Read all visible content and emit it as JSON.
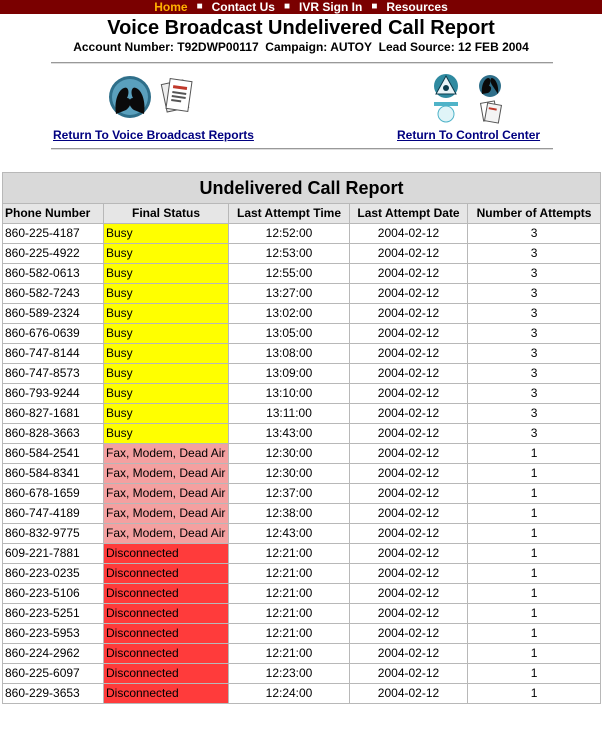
{
  "nav": {
    "items": [
      {
        "label": "Home",
        "active": true
      },
      {
        "label": "Contact Us",
        "active": false
      },
      {
        "label": "IVR Sign In",
        "active": false
      },
      {
        "label": "Resources",
        "active": false
      }
    ],
    "separator": "■",
    "bar_color": "#7a0000",
    "active_color": "#ffb000"
  },
  "header": {
    "title": "Voice Broadcast Undelivered Call Report",
    "account_label": "Account Number:",
    "account_number": "T92DWP00117",
    "campaign_label": "Campaign:",
    "campaign": "AUTOY",
    "lead_source_label": "Lead Source:",
    "lead_source": "12 FEB 2004"
  },
  "links": {
    "voice_broadcast_reports": "Return To Voice Broadcast Reports",
    "control_center": "Return To Control Center",
    "voice_broadcast_icon": "people-heads-icon",
    "reports_icon": "report-documents-icon",
    "control_center_icon": "control-center-icons"
  },
  "table": {
    "caption": "Undelivered Call Report",
    "columns": [
      "Phone Number",
      "Final Status",
      "Last Attempt Time",
      "Last Attempt Date",
      "Number of Attempts"
    ],
    "status_colors": {
      "Busy": "#ffff00",
      "Fax, Modem, Dead Air": "#f4a0a0",
      "Disconnected": "#ff3b3b"
    },
    "rows": [
      {
        "phone": "860-225-4187",
        "status": "Busy",
        "time": "12:52:00",
        "date": "2004-02-12",
        "attempts": "3"
      },
      {
        "phone": "860-225-4922",
        "status": "Busy",
        "time": "12:53:00",
        "date": "2004-02-12",
        "attempts": "3"
      },
      {
        "phone": "860-582-0613",
        "status": "Busy",
        "time": "12:55:00",
        "date": "2004-02-12",
        "attempts": "3"
      },
      {
        "phone": "860-582-7243",
        "status": "Busy",
        "time": "13:27:00",
        "date": "2004-02-12",
        "attempts": "3"
      },
      {
        "phone": "860-589-2324",
        "status": "Busy",
        "time": "13:02:00",
        "date": "2004-02-12",
        "attempts": "3"
      },
      {
        "phone": "860-676-0639",
        "status": "Busy",
        "time": "13:05:00",
        "date": "2004-02-12",
        "attempts": "3"
      },
      {
        "phone": "860-747-8144",
        "status": "Busy",
        "time": "13:08:00",
        "date": "2004-02-12",
        "attempts": "3"
      },
      {
        "phone": "860-747-8573",
        "status": "Busy",
        "time": "13:09:00",
        "date": "2004-02-12",
        "attempts": "3"
      },
      {
        "phone": "860-793-9244",
        "status": "Busy",
        "time": "13:10:00",
        "date": "2004-02-12",
        "attempts": "3"
      },
      {
        "phone": "860-827-1681",
        "status": "Busy",
        "time": "13:11:00",
        "date": "2004-02-12",
        "attempts": "3"
      },
      {
        "phone": "860-828-3663",
        "status": "Busy",
        "time": "13:43:00",
        "date": "2004-02-12",
        "attempts": "3"
      },
      {
        "phone": "860-584-2541",
        "status": "Fax, Modem, Dead Air",
        "time": "12:30:00",
        "date": "2004-02-12",
        "attempts": "1"
      },
      {
        "phone": "860-584-8341",
        "status": "Fax, Modem, Dead Air",
        "time": "12:30:00",
        "date": "2004-02-12",
        "attempts": "1"
      },
      {
        "phone": "860-678-1659",
        "status": "Fax, Modem, Dead Air",
        "time": "12:37:00",
        "date": "2004-02-12",
        "attempts": "1"
      },
      {
        "phone": "860-747-4189",
        "status": "Fax, Modem, Dead Air",
        "time": "12:38:00",
        "date": "2004-02-12",
        "attempts": "1"
      },
      {
        "phone": "860-832-9775",
        "status": "Fax, Modem, Dead Air",
        "time": "12:43:00",
        "date": "2004-02-12",
        "attempts": "1"
      },
      {
        "phone": "609-221-7881",
        "status": "Disconnected",
        "time": "12:21:00",
        "date": "2004-02-12",
        "attempts": "1"
      },
      {
        "phone": "860-223-0235",
        "status": "Disconnected",
        "time": "12:21:00",
        "date": "2004-02-12",
        "attempts": "1"
      },
      {
        "phone": "860-223-5106",
        "status": "Disconnected",
        "time": "12:21:00",
        "date": "2004-02-12",
        "attempts": "1"
      },
      {
        "phone": "860-223-5251",
        "status": "Disconnected",
        "time": "12:21:00",
        "date": "2004-02-12",
        "attempts": "1"
      },
      {
        "phone": "860-223-5953",
        "status": "Disconnected",
        "time": "12:21:00",
        "date": "2004-02-12",
        "attempts": "1"
      },
      {
        "phone": "860-224-2962",
        "status": "Disconnected",
        "time": "12:21:00",
        "date": "2004-02-12",
        "attempts": "1"
      },
      {
        "phone": "860-225-6097",
        "status": "Disconnected",
        "time": "12:23:00",
        "date": "2004-02-12",
        "attempts": "1"
      },
      {
        "phone": "860-229-3653",
        "status": "Disconnected",
        "time": "12:24:00",
        "date": "2004-02-12",
        "attempts": "1"
      }
    ]
  }
}
